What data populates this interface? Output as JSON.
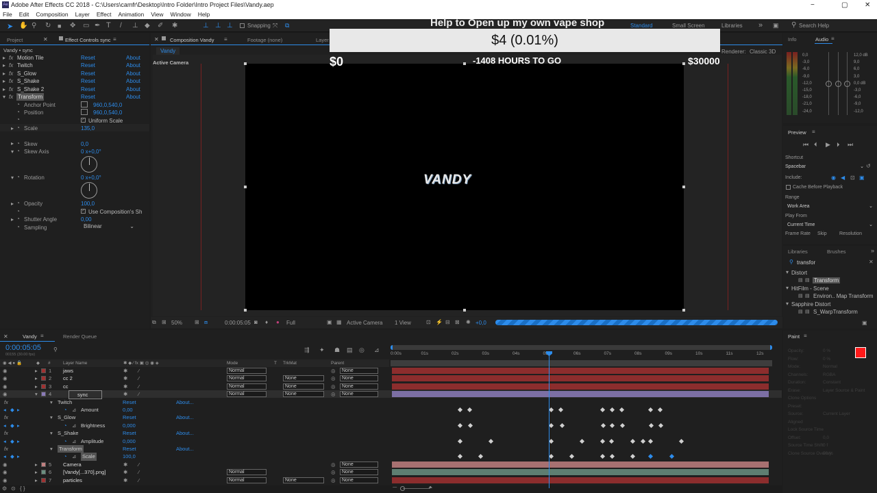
{
  "window": {
    "title": "Adobe After Effects CC 2018 - C:\\Users\\camfr\\Desktop\\Intro Folder\\Intro Project Files\\Vandy.aep",
    "minimize": "−",
    "maximize": "▢",
    "close": "✕"
  },
  "menu": [
    "File",
    "Edit",
    "Composition",
    "Layer",
    "Effect",
    "Animation",
    "View",
    "Window",
    "Help"
  ],
  "toolbar": {
    "snapping": "Snapping",
    "workspaces": [
      "Standard",
      "Small Screen",
      "Libraries"
    ],
    "search": "Search Help"
  },
  "left_panel": {
    "tabs": [
      "Project",
      "Effect Controls sync"
    ],
    "header": "Vandy • sync",
    "effects": [
      {
        "name": "Motion Tile",
        "reset": "Reset",
        "about": "About"
      },
      {
        "name": "Twitch",
        "reset": "Reset",
        "about": "About"
      },
      {
        "name": "S_Glow",
        "reset": "Reset",
        "about": "About"
      },
      {
        "name": "S_Shake",
        "reset": "Reset",
        "about": "About"
      },
      {
        "name": "S_Shake 2",
        "reset": "Reset",
        "about": "About"
      },
      {
        "name": "Transform",
        "reset": "Reset",
        "about": "About"
      }
    ],
    "props": {
      "anchor_label": "Anchor Point",
      "anchor": "960,0,540,0",
      "position_label": "Position",
      "position": "960,0,540,0",
      "uniform": "Uniform Scale",
      "scale_label": "Scale",
      "scale": "135,0",
      "skew_label": "Skew",
      "skew": "0,0",
      "skew_axis_label": "Skew Axis",
      "skew_axis": "0 x+0,0°",
      "rotation_label": "Rotation",
      "rotation": "0 x+0,0°",
      "opacity_label": "Opacity",
      "opacity": "100,0",
      "use_comp": "Use Composition's Sh",
      "shutter_label": "Shutter Angle",
      "shutter": "0,00",
      "sampling_label": "Sampling",
      "sampling": "Bilinear"
    }
  },
  "comp": {
    "tabs": [
      "Composition Vandy",
      "Footage (none)",
      "Layer"
    ],
    "sub_tab": "Vandy",
    "active_camera": "Active Camera",
    "renderer": "Renderer:",
    "classic": "Classic 3D",
    "logo": "VANDY",
    "footer": {
      "zoom": "50%",
      "time": "0:00:05:05",
      "res": "Full",
      "camera": "Active Camera",
      "view": "1 View",
      "offset": "+0,0"
    }
  },
  "overlay": {
    "title": "Help to Open up my own vape shop",
    "amount": "$4 (0.01%)",
    "min": "$0",
    "hours": "-1408 HOURS TO GO",
    "max": "$30000"
  },
  "right_panel": {
    "info_tab": "Info",
    "audio_tab": "Audio",
    "audio_left": [
      "0,0",
      "-3,0",
      "-6,0",
      "-9,0",
      "-12,0",
      "-15,0",
      "-18,0",
      "-21,0",
      "-24,0"
    ],
    "audio_right": [
      "12,0 dB",
      "9,0",
      "6,0",
      "3,0",
      "0,0 dB",
      "-3,0",
      "-6,0",
      "-9,0",
      "-12,0"
    ],
    "preview": "Preview",
    "shortcut_label": "Shortcut",
    "shortcut": "Spacebar",
    "include": "Include:",
    "cache": "Cache Before Playback",
    "range_label": "Range",
    "range": "Work Area",
    "playfrom_label": "Play From",
    "playfrom": "Current Time",
    "framerate": "Frame Rate",
    "skip": "Skip",
    "resolution": "Resolution",
    "libraries": "Libraries",
    "brushes": "Brushes",
    "search": "transfor",
    "groups": [
      {
        "name": "Distort",
        "items": [
          "Transform"
        ]
      },
      {
        "name": "HitFilm - Scene",
        "items": [
          "Environ.. Map Transform"
        ]
      },
      {
        "name": "Sapphire Distort",
        "items": [
          "S_WarpTransform"
        ]
      }
    ],
    "paint": "Paint",
    "paint_labels": [
      "Opacity:",
      "Flow:",
      "Mode:",
      "Channels:",
      "Duration:",
      "Erase:",
      "Clone Options",
      "Preset:",
      "Source:",
      "Aligned",
      "Lock Source Time",
      "Offset:",
      "Source Time Shift:",
      "Clone Source Overlay:"
    ],
    "paint_values": [
      "0 %",
      "0 %",
      "Normal",
      "RGBA",
      "Constant",
      "Layer Source & Paint",
      "",
      "",
      "Current Layer",
      "",
      "",
      "0,0",
      "0 f",
      "50 %"
    ]
  },
  "timeline": {
    "tabs": [
      "Vandy",
      "Render Queue"
    ],
    "timecode": "0:00:05:05",
    "fps": "00155 (30.00 fps)",
    "columns": {
      "name": "Layer Name",
      "mode": "Mode",
      "t": "T",
      "trkmat": "TrkMat",
      "parent": "Parent"
    },
    "ruler": [
      "0:00s",
      "01s",
      "02s",
      "03s",
      "04s",
      "05s",
      "06s",
      "07s",
      "08s",
      "09s",
      "10s",
      "11s",
      "12s"
    ],
    "layers": [
      {
        "num": "1",
        "name": "jaws",
        "mode": "Normal",
        "trk": "",
        "parent": "None",
        "color": "#a03030"
      },
      {
        "num": "2",
        "name": "cc 2",
        "mode": "Normal",
        "trk": "None",
        "parent": "None",
        "color": "#a03030"
      },
      {
        "num": "3",
        "name": "cc",
        "mode": "Normal",
        "trk": "None",
        "parent": "None",
        "color": "#a03030"
      },
      {
        "num": "4",
        "name": "sync",
        "mode": "Normal",
        "trk": "None",
        "parent": "None",
        "color": "#8a7ab8"
      }
    ],
    "sub": [
      {
        "name": "Twitch",
        "reset": "Reset",
        "about": "About..."
      },
      {
        "name": "Amount",
        "value": "0,00"
      },
      {
        "name": "S_Glow",
        "reset": "Reset",
        "about": "About..."
      },
      {
        "name": "Brightness",
        "value": "0,000"
      },
      {
        "name": "S_Shake",
        "reset": "Reset",
        "about": "About..."
      },
      {
        "name": "Amplitude",
        "value": "0,000"
      },
      {
        "name": "Transform",
        "reset": "Reset",
        "about": "About..."
      },
      {
        "name": "Scale",
        "value": "100,0"
      }
    ],
    "bottom_layers": [
      {
        "num": "5",
        "name": "Camera",
        "mode": "",
        "trk": "",
        "parent": "None",
        "color": "#c08080"
      },
      {
        "num": "6",
        "name": "[Vandy[...370].png]",
        "mode": "Normal",
        "trk": "",
        "parent": "None",
        "color": "#6a8f80"
      },
      {
        "num": "7",
        "name": "particles",
        "mode": "Normal",
        "trk": "None",
        "parent": "None",
        "color": "#a03030"
      }
    ]
  }
}
